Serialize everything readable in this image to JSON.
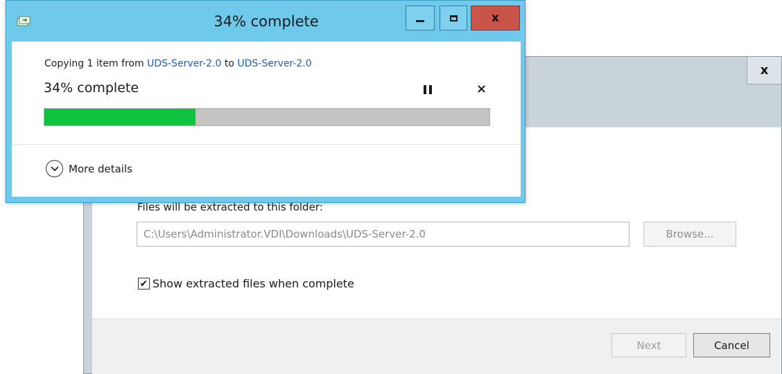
{
  "wizard": {
    "close_label": "x",
    "folder_label": "Files will be extracted to this folder:",
    "path_value": "C:\\Users\\Administrator.VDI\\Downloads\\UDS-Server-2.0",
    "browse_label": "Browse...",
    "show_files_label": "Show extracted files when complete",
    "show_files_checked": true,
    "next_label": "Next",
    "cancel_label": "Cancel"
  },
  "copy_dialog": {
    "title": "34% complete",
    "copying_prefix": "Copying 1 item from ",
    "source": "UDS-Server-2.0",
    "to_word": " to ",
    "destination": "UDS-Server-2.0",
    "status": "34% complete",
    "progress_percent": 34,
    "more_details_label": "More details",
    "close_label": "x",
    "cancel_glyph": "×"
  },
  "colors": {
    "title_bar": "#6fc9ea",
    "progress_fill": "#0fc23f",
    "link": "#1f5fb0",
    "close_button": "#c8544a"
  },
  "icons": [
    "copy-app-icon",
    "minimize-icon",
    "maximize-icon",
    "close-icon",
    "pause-icon",
    "cancel-icon",
    "chevron-down-icon",
    "checkmark-icon"
  ]
}
